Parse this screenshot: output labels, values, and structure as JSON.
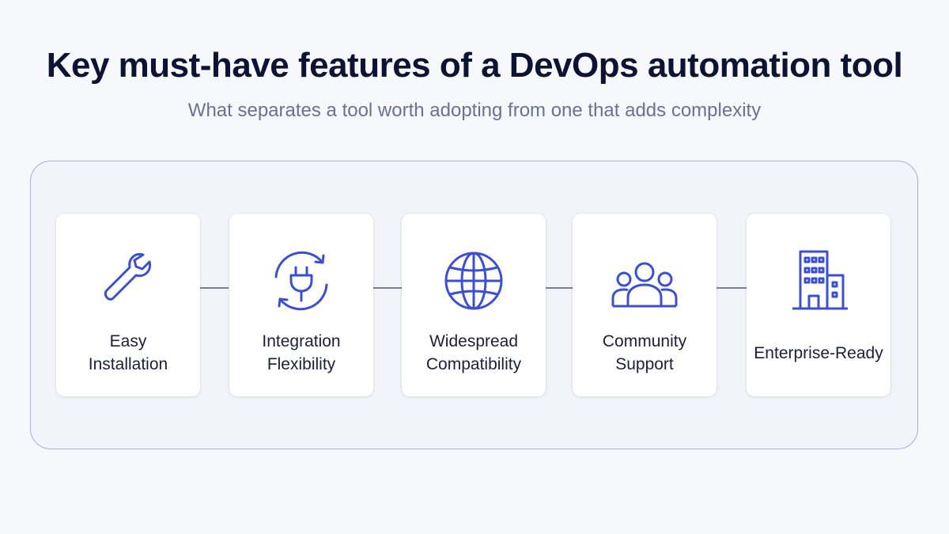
{
  "title": "Key must-have features of a DevOps automation tool",
  "subtitle": "What separates a tool worth adopting from one that adds complexity",
  "accent_color": "#3d4fd1",
  "features": [
    {
      "label_line1": "Easy",
      "label_line2": "Installation",
      "icon": "wrench-icon"
    },
    {
      "label_line1": "Integration",
      "label_line2": "Flexibility",
      "icon": "plug-cycle-icon"
    },
    {
      "label_line1": "Widespread",
      "label_line2": "Compatibility",
      "icon": "globe-icon"
    },
    {
      "label_line1": "Community",
      "label_line2": "Support",
      "icon": "people-icon"
    },
    {
      "label_line1": "Enterprise-Ready",
      "label_line2": "",
      "icon": "building-icon"
    }
  ]
}
